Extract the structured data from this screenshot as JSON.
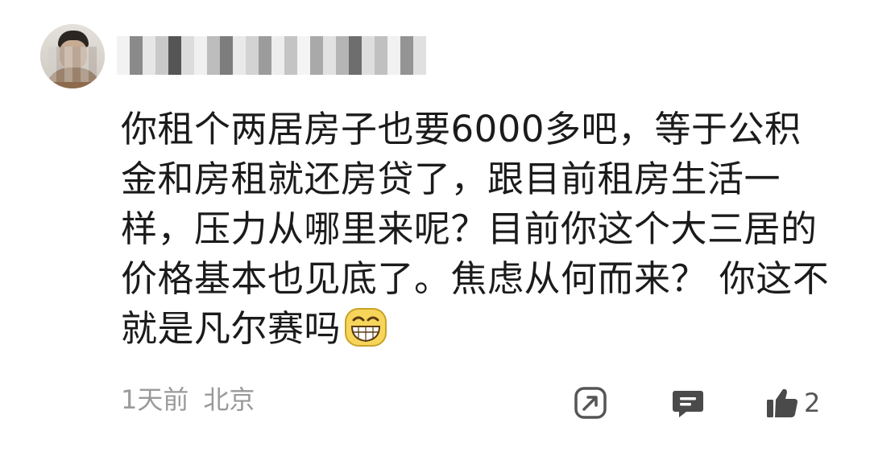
{
  "comment": {
    "username_redacted": true,
    "text": "你租个两居房子也要6000多吧，等于公积金和房租就还房贷了，跟目前租房生活一样，压力从哪里来呢？目前你这个大三居的价格基本也见底了。焦虑从何而来？ 你这不就是凡尔赛吗",
    "emoji": "grinning-squint-emoji",
    "time": "1天前",
    "location": "北京",
    "share_icon": "share-icon",
    "reply_icon": "reply-icon",
    "like_icon": "thumbs-up-icon",
    "like_count": "2"
  }
}
